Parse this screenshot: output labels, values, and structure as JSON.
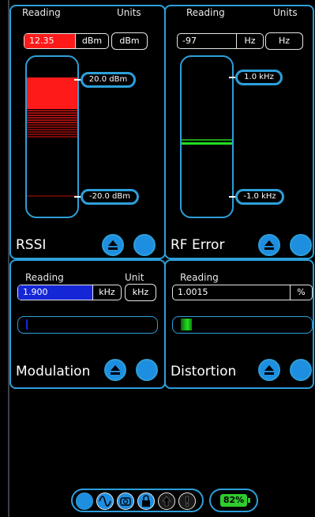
{
  "rssi": {
    "reading_label": "Reading",
    "units_label": "Units",
    "reading_value": "12.35",
    "reading_unit": "dBm",
    "units_button": "dBm",
    "top_marker": "20.0 dBm",
    "bottom_marker": "-20.0 dBm",
    "title": "RSSI",
    "accent_color": "#ff1a1a"
  },
  "rf_error": {
    "reading_label": "Reading",
    "units_label": "Units",
    "reading_value": "-97",
    "reading_unit": "Hz",
    "units_button": "Hz",
    "top_marker": "1.0 kHz",
    "bottom_marker": "-1.0 kHz",
    "title": "RF Error",
    "accent_color": "#22dd22"
  },
  "modulation": {
    "reading_label": "Reading",
    "units_label": "Unit",
    "reading_value": "1.900",
    "reading_unit": "kHz",
    "units_button": "kHz",
    "title": "Modulation",
    "accent_color": "#1426d6"
  },
  "distortion": {
    "reading_label": "Reading",
    "reading_value": "1.0015",
    "reading_unit": "%",
    "title": "Distortion",
    "accent_color": "#22dd22"
  },
  "status": {
    "battery_percent": "82%",
    "battery_color": "#2ecc2e"
  },
  "icons": [
    "eject-icon",
    "circle-button-icon",
    "sine-wave-icon",
    "camera-icon",
    "lock-icon",
    "up-arrow-icon",
    "exclamation-icon"
  ]
}
